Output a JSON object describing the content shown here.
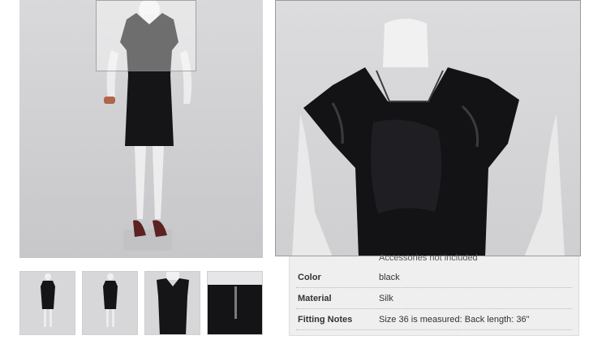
{
  "product": {
    "main_image": "black-dress-mannequin-front",
    "zoom_image": "black-dress-zoom-bodice",
    "thumbnails": [
      {
        "image": "dress-front-full"
      },
      {
        "image": "dress-back-full"
      },
      {
        "image": "dress-front-closeup"
      },
      {
        "image": "dress-back-zipper"
      }
    ]
  },
  "details": {
    "partial_text": "Accessories not included",
    "rows": [
      {
        "label": "Color",
        "value": "black"
      },
      {
        "label": "Material",
        "value": "Silk"
      },
      {
        "label": "Fitting Notes",
        "value": "Size 36 is measured: Back length: 36\""
      }
    ]
  },
  "colors": {
    "dress": "#1a1a1d",
    "background": "#d4d4d6",
    "panel": "#efefef"
  }
}
